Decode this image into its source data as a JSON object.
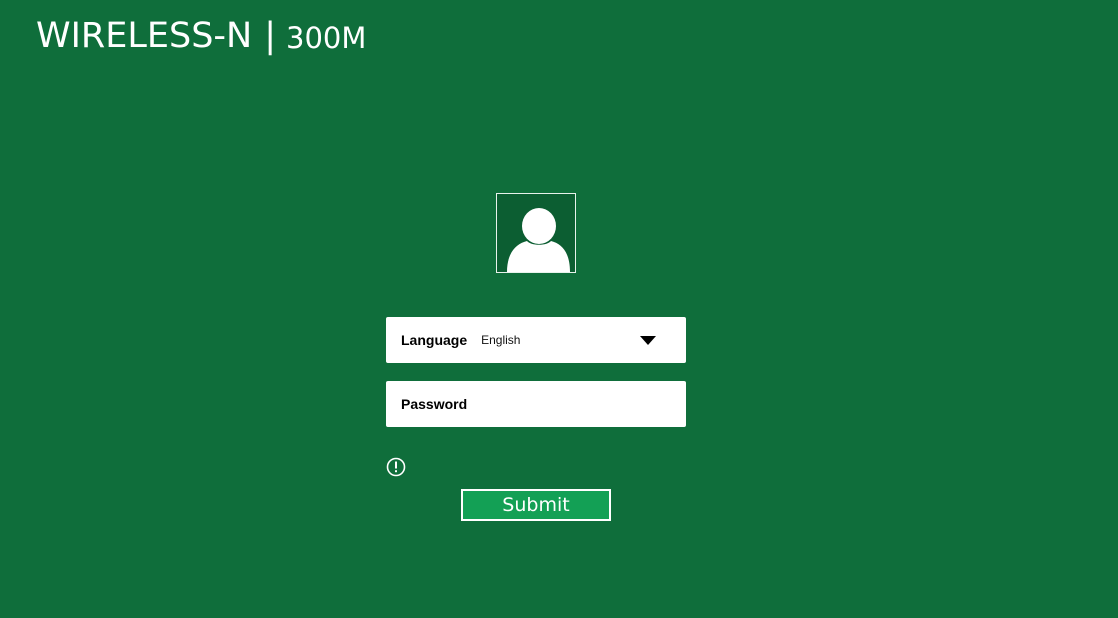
{
  "header": {
    "brand": "WIRELESS-N",
    "separator": "|",
    "model": "300M"
  },
  "login": {
    "avatar_icon": "user-avatar-icon",
    "language": {
      "label": "Language",
      "selected": "English",
      "dropdown_icon": "caret-down-icon"
    },
    "password": {
      "label": "Password",
      "value": "",
      "placeholder": ""
    },
    "warning_icon": "exclamation-circle-icon",
    "submit_label": "Submit"
  },
  "colors": {
    "background": "#0f6e3b",
    "avatar_bg": "#0c5e32",
    "button_bg": "#13a055",
    "text": "#ffffff",
    "field_bg": "#ffffff"
  }
}
